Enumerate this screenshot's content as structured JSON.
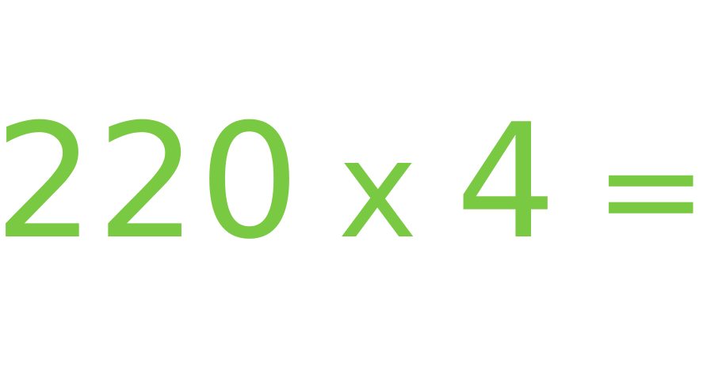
{
  "equation": {
    "operand_a": "220",
    "operator": "x",
    "operand_b": "4",
    "equals": "="
  },
  "colors": {
    "text": "#7ac943",
    "background": "#ffffff"
  }
}
